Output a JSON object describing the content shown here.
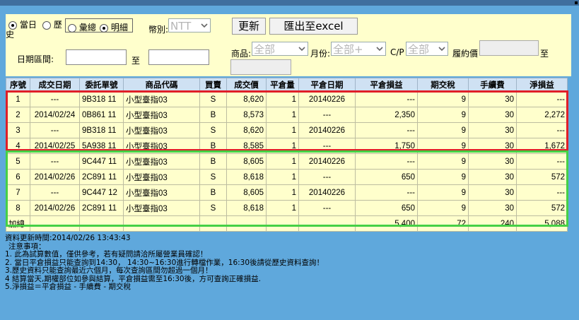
{
  "filters": {
    "radio_today": "當日",
    "radio_history_a": "歷",
    "radio_history_b": "史",
    "radio_summary": "彙總",
    "radio_detail": "明細",
    "currency_label": "幣別:",
    "currency_value": "NTT",
    "refresh_label": "更新",
    "export_label": "匯出至excel",
    "date_range_label": "日期區間:",
    "to_label_1": "至",
    "product_label": "商品:",
    "product_value": "全部",
    "month_label": "月份:",
    "month_value": "全部+",
    "cp_label": "C/P",
    "cp_value": "全部",
    "strike_label": "履約價",
    "to_label_2": "至"
  },
  "table": {
    "headers": [
      "序號",
      "成交日期",
      "委託單號",
      "商品代碼",
      "買賣",
      "成交價",
      "平倉量",
      "平倉日期",
      "平倉損益",
      "期交稅",
      "手續費",
      "淨損益"
    ],
    "rows": [
      [
        "1",
        "---",
        "9B318 11",
        "小型臺指03",
        "S",
        "8,620",
        "1",
        "20140226",
        "---",
        "9",
        "30",
        "---"
      ],
      [
        "2",
        "2014/02/24",
        "0B861 11",
        "小型臺指03",
        "B",
        "8,573",
        "1",
        "---",
        "2,350",
        "9",
        "30",
        "2,272"
      ],
      [
        "3",
        "---",
        "9B318 11",
        "小型臺指03",
        "S",
        "8,620",
        "1",
        "20140226",
        "---",
        "9",
        "30",
        "---"
      ],
      [
        "4",
        "2014/02/25",
        "5A938 11",
        "小型臺指03",
        "B",
        "8,585",
        "1",
        "---",
        "1,750",
        "9",
        "30",
        "1,672"
      ],
      [
        "5",
        "---",
        "9C447 11",
        "小型臺指03",
        "B",
        "8,605",
        "1",
        "20140226",
        "---",
        "9",
        "30",
        "---"
      ],
      [
        "6",
        "2014/02/26",
        "2C891 11",
        "小型臺指03",
        "S",
        "8,618",
        "1",
        "---",
        "650",
        "9",
        "30",
        "572"
      ],
      [
        "7",
        "---",
        "9C447 12",
        "小型臺指03",
        "B",
        "8,605",
        "1",
        "20140226",
        "---",
        "9",
        "30",
        "---"
      ],
      [
        "8",
        "2014/02/26",
        "2C891 11",
        "小型臺指03",
        "S",
        "8,618",
        "1",
        "---",
        "650",
        "9",
        "30",
        "572"
      ]
    ],
    "total": [
      "加總",
      "",
      "",
      "",
      "",
      "",
      "",
      "",
      "5,400",
      "72",
      "240",
      "5,088"
    ]
  },
  "notes": {
    "update_time": "資料更新時間:2014/02/26 13:43:43",
    "title": "注意事項：",
    "items": [
      "1. 此為試算數值，僅供參考，若有疑問請洽所屬營業員確認！",
      "2. 當日平倉損益只能查詢到14:30， 14:30~16:30進行轉檔作業，16:30後請從歷史資料查詢！",
      "3.歷史資料只能查詢最近六個月，每次查詢區間勿超過一個月！",
      "4 結算當天,期權部位如參與結算，平倉損益需至16:30後，方可查詢正確損益.",
      "5.淨損益＝平倉損益 - 手續費 - 期交稅"
    ]
  },
  "colors": {
    "background": "#5fa8dc",
    "panel": "#ffffcc",
    "header": "#cfe1f3",
    "highlight_red": "#e01e28",
    "highlight_green": "#46d046"
  }
}
